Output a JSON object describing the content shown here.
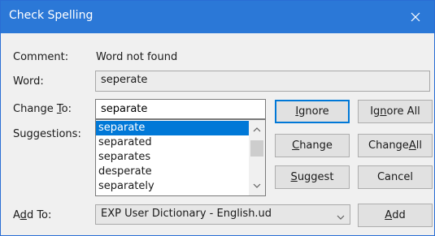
{
  "window": {
    "title": "Check Spelling"
  },
  "labels": {
    "comment": "Comment:",
    "word": "Word:",
    "change_to_before": "Change ",
    "change_to_mnemonic": "T",
    "change_to_after": "o:",
    "suggestions": "Suggestions:",
    "add_to_before": "A",
    "add_to_mnemonic": "d",
    "add_to_after": "d To:"
  },
  "comment_value": "Word not found",
  "word_value": "seperate",
  "change_to_value": "separate",
  "suggestions": {
    "items": [
      "separate",
      "separated",
      "separates",
      "desperate",
      "separately"
    ],
    "selected_index": 0
  },
  "buttons": {
    "ignore": {
      "before": "",
      "mnemonic": "I",
      "after": "gnore"
    },
    "ignore_all": {
      "before": "Ig",
      "mnemonic": "n",
      "after": "ore All"
    },
    "change": {
      "before": "",
      "mnemonic": "C",
      "after": "hange"
    },
    "change_all": {
      "before": "Change ",
      "mnemonic": "A",
      "after": "ll"
    },
    "suggest": {
      "before": "",
      "mnemonic": "S",
      "after": "uggest"
    },
    "cancel": {
      "before": "Cancel",
      "mnemonic": "",
      "after": ""
    },
    "add": {
      "before": "",
      "mnemonic": "A",
      "after": "dd"
    }
  },
  "add_to": {
    "selected": "EXP User Dictionary - English.ud"
  },
  "icons": {
    "close": "close-icon",
    "scroll_up": "chevron-up-icon",
    "scroll_down": "chevron-down-icon",
    "dropdown": "chevron-down-icon"
  },
  "colors": {
    "title_bar": "#2b78d7",
    "selection": "#0078d7",
    "dialog_background": "#f0f0f0"
  }
}
